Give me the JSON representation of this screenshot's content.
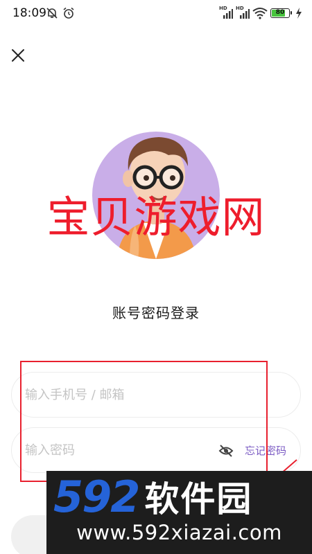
{
  "status_bar": {
    "time": "18:09",
    "network_badge_1": "HD",
    "network_badge_2": "HD",
    "battery_percent": "80",
    "battery_level": 0.8
  },
  "icons": {
    "close": "close-icon",
    "eye": "eye-off-icon",
    "bell": "mute-bell-icon",
    "alarm": "alarm-icon",
    "wifi": "wifi-icon",
    "charging": "charging-icon"
  },
  "watermark": {
    "text": "宝贝游戏网"
  },
  "login": {
    "title": "账号密码登录",
    "account_placeholder": "输入手机号 / 邮箱",
    "account_value": "",
    "password_placeholder": "输入密码",
    "password_value": "",
    "forgot_label": "忘记密码"
  },
  "banner": {
    "number": "592",
    "name": "软件园",
    "url": "www.592xiazai.com"
  },
  "colors": {
    "accent": "#7c5cc4",
    "avatar_bg": "#c9aee8",
    "watermark_red": "#ee1d2c",
    "banner_blue": "#2563d8",
    "banner_bg": "#1d1d1d"
  }
}
